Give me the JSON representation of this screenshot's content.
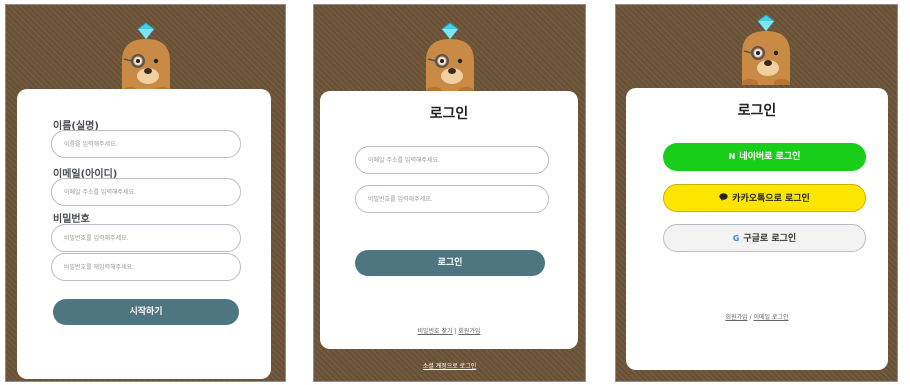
{
  "signup": {
    "name_label": "이름(실명)",
    "name_placeholder": "이름을 입력해주세요.",
    "email_label": "이메일(아이디)",
    "email_placeholder": "이메일 주소를 입력해주세요.",
    "password_label": "비밀번호",
    "password_placeholder": "비밀번호를 입력해주세요.",
    "password_confirm_placeholder": "비밀번호를 재입력해주세요.",
    "start_button": "시작하기"
  },
  "email_login": {
    "title": "로그인",
    "email_placeholder": "이메일 주소를 입력해주세요.",
    "password_placeholder": "비밀번호를 입력해주세요.",
    "login_button": "로그인",
    "find_password_link": "비밀번호 찾기",
    "separator": "|",
    "signup_link": "회원가입",
    "social_login_link": "소셜 계정으로 로그인"
  },
  "social_login": {
    "title": "로그인",
    "naver_button": "네이버로 로그인",
    "naver_icon_char": "N",
    "kakao_button": "카카오톡으로 로그인",
    "google_button": "구글로 로그인",
    "google_icon_char": "G",
    "signup_link": "회원가입",
    "separator": "/",
    "email_login_link": "이메일 로그인"
  },
  "colors": {
    "background": "#6e5539",
    "primary": "#4e7680",
    "naver": "#19ce19",
    "kakao": "#fee500",
    "google_bg": "#f3f3f3",
    "mascot": "#c98a46",
    "diamond": "#3ecfe6"
  },
  "icons": {
    "mascot": "mole-with-monocle-icon",
    "diamond": "diamond-icon",
    "kakao": "speech-bubble-icon",
    "google": "google-g-icon",
    "naver": "naver-n-icon"
  }
}
